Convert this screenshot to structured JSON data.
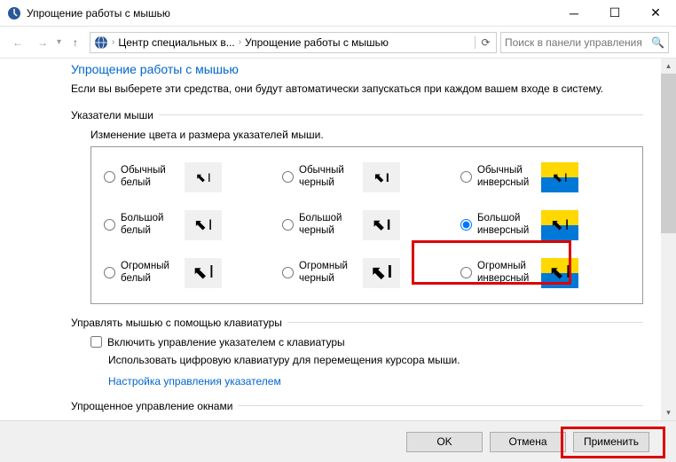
{
  "window": {
    "title": "Упрощение работы с мышью"
  },
  "nav": {
    "crumb1": "Центр специальных в...",
    "crumb2": "Упрощение работы с мышью",
    "search_placeholder": "Поиск в панели управления"
  },
  "page": {
    "heading": "Упрощение работы с мышью",
    "desc": "Если вы выберете эти средства, они будут автоматически запускаться при каждом вашем входе в систему."
  },
  "pointers": {
    "section_title": "Указатели мыши",
    "sub_label": "Изменение цвета и размера указателей мыши.",
    "options": [
      {
        "label": "Обычный белый"
      },
      {
        "label": "Обычный черный"
      },
      {
        "label": "Обычный инверсный"
      },
      {
        "label": "Большой белый"
      },
      {
        "label": "Большой черный"
      },
      {
        "label": "Большой инверсный"
      },
      {
        "label": "Огромный белый"
      },
      {
        "label": "Огромный черный"
      },
      {
        "label": "Огромный инверсный"
      }
    ],
    "selected_index": 5
  },
  "keyboard_mouse": {
    "section_title": "Управлять мышью с помощью клавиатуры",
    "checkbox_label": "Включить управление указателем с клавиатуры",
    "desc": "Использовать цифровую клавиатуру для перемещения курсора мыши.",
    "link": "Настройка управления указателем"
  },
  "windows_mgmt": {
    "section_title": "Упрощенное управление окнами"
  },
  "buttons": {
    "ok": "OK",
    "cancel": "Отмена",
    "apply": "Применить"
  }
}
